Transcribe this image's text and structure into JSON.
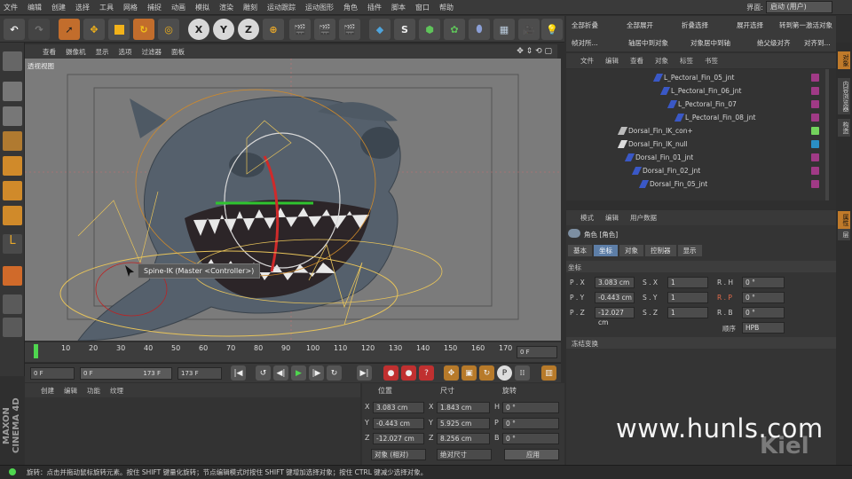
{
  "menu": [
    "文件",
    "编辑",
    "创建",
    "选择",
    "工具",
    "网格",
    "捕捉",
    "动画",
    "模拟",
    "渲染",
    "雕刻",
    "运动跟踪",
    "运动图形",
    "角色",
    "插件",
    "脚本",
    "窗口",
    "帮助"
  ],
  "layout": {
    "label": "界面:",
    "value": "启动 (用户)"
  },
  "viewport": {
    "menu": [
      "查看",
      "摄像机",
      "显示",
      "选项",
      "过滤器",
      "面板"
    ],
    "name": "透视视图",
    "tooltip": "Spine-IK (Master <Controller>)"
  },
  "timeline": {
    "ticks": [
      "0",
      "10",
      "20",
      "30",
      "40",
      "50",
      "60",
      "70",
      "80",
      "90",
      "100",
      "110",
      "120",
      "130",
      "140",
      "150",
      "160",
      "170"
    ],
    "current": "0 F"
  },
  "controls": {
    "start": "0 F",
    "range_start": "0 F",
    "range_end": "173 F",
    "end": "173 F"
  },
  "materials": {
    "menu": [
      "创建",
      "编辑",
      "功能",
      "纹理"
    ]
  },
  "coordinates": {
    "headers": {
      "position": "位置",
      "size": "尺寸",
      "rotation": "旋转"
    },
    "rows": [
      {
        "axis": "X",
        "pos": "3.083 cm",
        "size_axis": "X",
        "size": "1.843 cm",
        "rot_axis": "H",
        "rot": "0 °"
      },
      {
        "axis": "Y",
        "pos": "-0.443 cm",
        "size_axis": "Y",
        "size": "5.925 cm",
        "rot_axis": "P",
        "rot": "0 °"
      },
      {
        "axis": "Z",
        "pos": "-12.027 cm",
        "size_axis": "Z",
        "size": "8.256 cm",
        "rot_axis": "B",
        "rot": "0 °"
      }
    ],
    "mode_object": "对象 (相对)",
    "mode_size": "绝对尺寸",
    "apply": "应用"
  },
  "object_toolbar": {
    "row1": [
      "全部折叠",
      "全部展开",
      "折叠选择",
      "展开选择",
      "转到第一激活对象"
    ],
    "row2": [
      "帧对所...",
      "轴居中到对象",
      "对象居中到轴",
      "绝父级对齐",
      "对齐到..."
    ]
  },
  "objects": {
    "menu": [
      "文件",
      "编辑",
      "查看",
      "对象",
      "标签",
      "书签"
    ],
    "tree": [
      {
        "name": "L_Pectoral_Fin_05_jnt",
        "indent": 100,
        "icon": "joint",
        "tag": "#a03a86"
      },
      {
        "name": "L_Pectoral_Fin_06_jnt",
        "indent": 108,
        "icon": "joint",
        "tag": "#a03a86"
      },
      {
        "name": "L_Pectoral_Fin_07",
        "indent": 116,
        "icon": "joint",
        "tag": "#a03a86"
      },
      {
        "name": "L_Pectoral_Fin_08_jnt",
        "indent": 124,
        "icon": "joint",
        "tag": "#a03a86"
      },
      {
        "name": "Dorsal_Fin_IK_con+",
        "indent": 60,
        "icon": "con",
        "tag": "#73d35c"
      },
      {
        "name": "Dorsal_Fin_IK_null",
        "indent": 60,
        "icon": "null",
        "tag": "#2a8fc4"
      },
      {
        "name": "Dorsal_Fin_01_jnt",
        "indent": 68,
        "icon": "joint",
        "tag": "#a03a86"
      },
      {
        "name": "Dorsal_Fin_02_jnt",
        "indent": 76,
        "icon": "joint",
        "tag": "#a03a86"
      },
      {
        "name": "Dorsal_Fin_05_jnt",
        "indent": 84,
        "icon": "joint",
        "tag": "#a03a86"
      }
    ]
  },
  "attributes": {
    "menu": [
      "模式",
      "编辑",
      "用户数据"
    ],
    "title": "角色 [角色]",
    "tabs": [
      "基本",
      "坐标",
      "对象",
      "控制器",
      "显示"
    ],
    "active_tab": "坐标",
    "section": "坐标",
    "rows": [
      {
        "p": "P . X",
        "pv": "3.083 cm",
        "s": "S . X",
        "sv": "1",
        "r": "R . H",
        "rv": "0 °"
      },
      {
        "p": "P . Y",
        "pv": "-0.443 cm",
        "s": "S . Y",
        "sv": "1",
        "r": "R . P",
        "rv": "0 °"
      },
      {
        "p": "P . Z",
        "pv": "-12.027 cm",
        "s": "S . Z",
        "sv": "1",
        "r": "R . B",
        "rv": "0 °"
      }
    ],
    "order_label": "顺序",
    "order_value": "HPB",
    "freeze": "冻结变换"
  },
  "right_strip": [
    "对象",
    "内容浏览器",
    "构造",
    "属性",
    "层"
  ],
  "status": "旋转：点击并拖动鼠标旋转元素。按住 SHIFT 键量化旋转；节点编辑模式时按住 SHIFT 键增加选择对象；按住 CTRL 键减少选择对象。",
  "watermark": "www.hunls.com",
  "brand": "MAXON CINEMA 4D",
  "kiel": "Kiel"
}
